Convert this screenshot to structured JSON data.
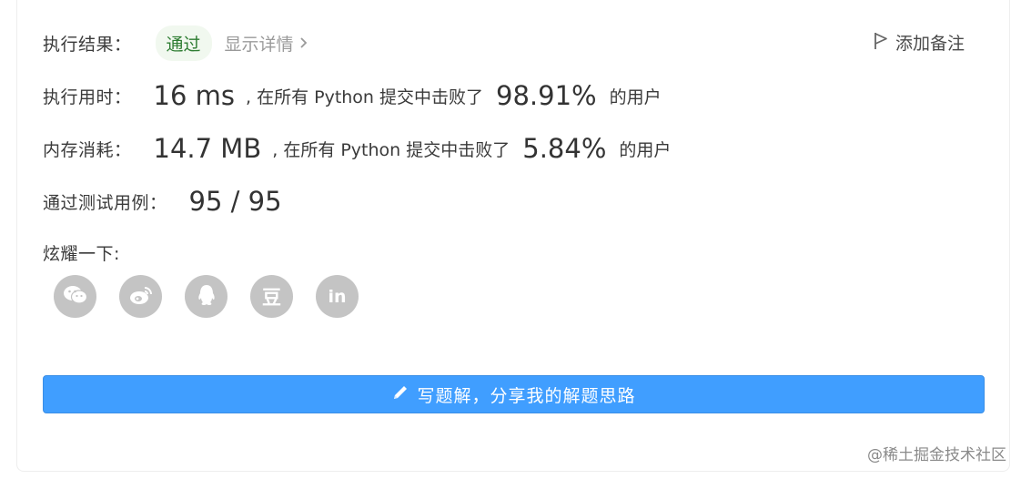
{
  "result": {
    "label": "执行结果：",
    "status": "通过",
    "details_link": "显示详情",
    "add_note": "添加备注"
  },
  "runtime": {
    "label": "执行用时：",
    "value": "16 ms",
    "middle_text": ", 在所有 Python 提交中击败了",
    "percent": "98.91%",
    "suffix": "的用户"
  },
  "memory": {
    "label": "内存消耗：",
    "value": "14.7 MB",
    "middle_text": ", 在所有 Python 提交中击败了",
    "percent": "5.84%",
    "suffix": "的用户"
  },
  "testcases": {
    "label": "通过测试用例：",
    "value": "95 / 95"
  },
  "share": {
    "label": "炫耀一下:",
    "icons": [
      "wechat-icon",
      "weibo-icon",
      "qq-icon",
      "douban-icon",
      "linkedin-icon"
    ],
    "douban_glyph": "豆",
    "linkedin_glyph": "in"
  },
  "write_solution": {
    "label": "写题解，分享我的解题思路"
  },
  "watermark": "@稀土掘金技术社区",
  "colors": {
    "accent": "#409eff",
    "pass_green": "#2e7d32",
    "icon_gray": "#c4c4c4"
  }
}
